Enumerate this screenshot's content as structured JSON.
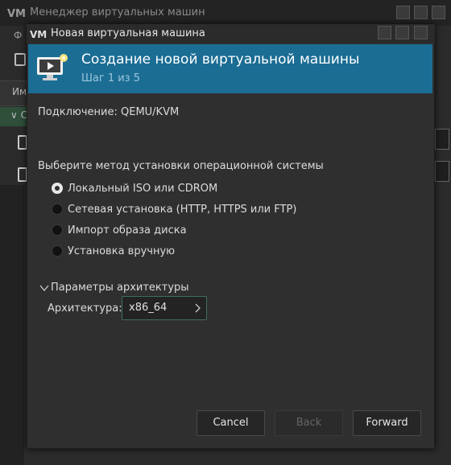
{
  "background_window": {
    "title": "Менеджер виртуальных машин",
    "menu_first_letter": "Ф",
    "column_header": "Им",
    "group_row_label": "С"
  },
  "dialog": {
    "title": "Новая виртуальная машина",
    "banner": {
      "title": "Создание новой виртуальной машины",
      "step": "Шаг 1 из 5"
    },
    "connection_label": "Подключение:",
    "connection_value": "QEMU/KVM",
    "install_method_heading": "Выберите метод установки операционной системы",
    "install_methods": [
      {
        "label": "Локальный ISO или CDROM",
        "selected": true
      },
      {
        "label": "Сетевая установка (HTTP, HTTPS или FTP)",
        "selected": false
      },
      {
        "label": "Импорт образа диска",
        "selected": false
      },
      {
        "label": "Установка вручную",
        "selected": false
      }
    ],
    "arch_section_label": "Параметры архитектуры",
    "arch_label": "Архитектура:",
    "arch_value": "x86_64",
    "buttons": {
      "cancel": "Cancel",
      "back": "Back",
      "forward": "Forward"
    }
  },
  "colors": {
    "banner": "#1b6d94",
    "dialog_bg": "#2f2f2f",
    "accent_border": "#3d6e63"
  }
}
